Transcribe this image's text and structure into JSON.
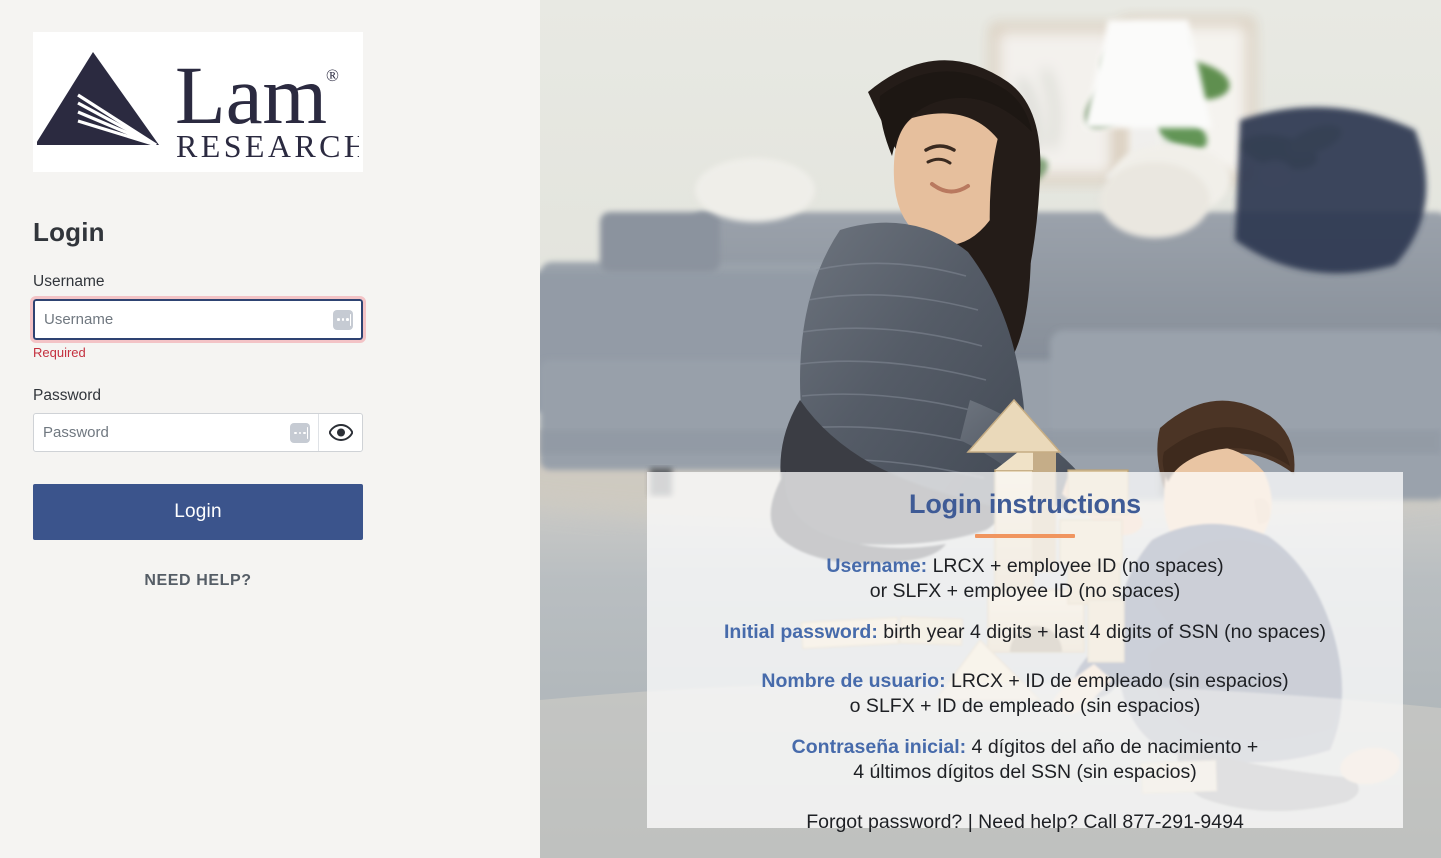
{
  "brand": {
    "logo_name": "lam-research-logo",
    "wordmark": "Lam",
    "registered": "®",
    "subtitle": "RESEARCH",
    "logo_color": "#2b2a40",
    "logo_bg": "#ffffff"
  },
  "login": {
    "title": "Login",
    "username": {
      "label": "Username",
      "value": "",
      "placeholder": "Username",
      "error": "Required",
      "focused": true
    },
    "password": {
      "label": "Password",
      "value": "",
      "placeholder": "Password",
      "reveal_icon": "eye-icon"
    },
    "submit_label": "Login",
    "need_help_label": "NEED HELP?"
  },
  "colors": {
    "panel_bg": "#f5f4f2",
    "primary_button": "#3b548c",
    "error_text": "#c4303f",
    "focus_border": "#2e4372",
    "error_ring": "#f3c3c6",
    "instructions_accent": "#f0955f",
    "instructions_label": "#476bab",
    "instructions_title": "#3f5b96"
  },
  "instructions": {
    "title": "Login instructions",
    "english": [
      {
        "label": "Username:",
        "text": " LRCX + employee ID (no spaces)"
      },
      {
        "label": "",
        "text": "or SLFX + employee ID (no spaces)"
      },
      {
        "label": "Initial password:",
        "text": " birth year 4 digits + last 4 digits of SSN (no spaces)"
      }
    ],
    "spanish": [
      {
        "label": "Nombre de usuario:",
        "text": " LRCX + ID de empleado (sin espacios)"
      },
      {
        "label": "",
        "text": "o SLFX + ID de empleado (sin espacios)"
      },
      {
        "label": "Contraseña inicial:",
        "text": " 4 dígitos del año de nacimiento +"
      },
      {
        "label": "",
        "text": "4 últimos dígitos del SSN (sin espacios)"
      }
    ],
    "footer": "Forgot password? | Need help? Call 877-291-9494"
  },
  "photo": {
    "alt_name": "woman-and-child-playing-with-wooden-blocks"
  }
}
